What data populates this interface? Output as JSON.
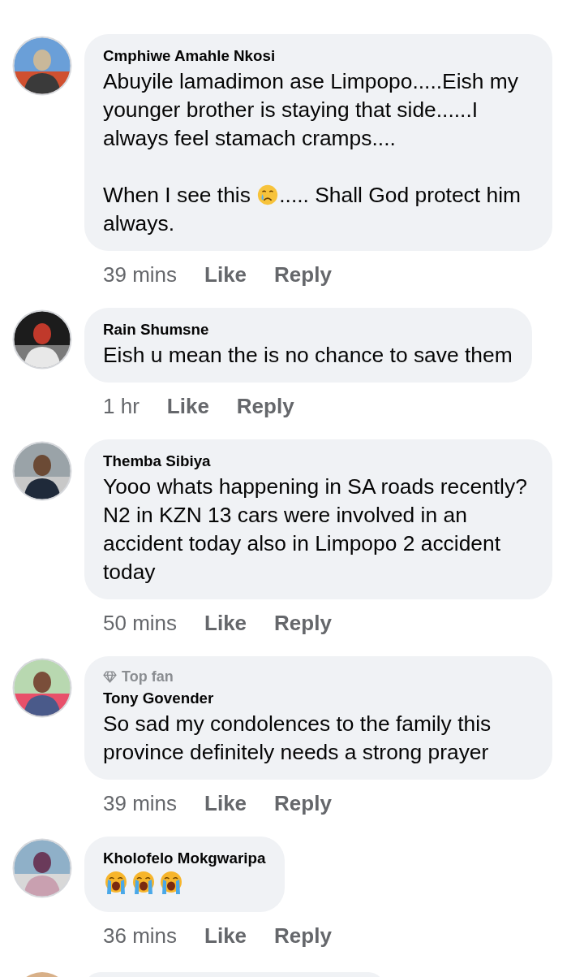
{
  "comments": [
    {
      "kind": "comment",
      "name": "Cmphiwe Amahle Nkosi",
      "paragraphs": [
        [
          {
            "kind": "text",
            "text": "Abuyile lamadimon ase Limpopo.....Eish my younger brother is staying that side......I always feel stamach cramps...."
          }
        ],
        [
          {
            "kind": "text",
            "text": "When I see this "
          },
          {
            "kind": "sad-emoji"
          },
          {
            "kind": "text",
            "text": "..... Shall God protect him always."
          }
        ]
      ],
      "time": "39 mins",
      "like": "Like",
      "reply": "Reply"
    },
    {
      "kind": "comment",
      "name": "Rain Shumsne",
      "paragraphs": [
        [
          {
            "kind": "text",
            "text": "Eish u mean the is no chance to save them"
          }
        ]
      ],
      "time": "1 hr",
      "like": "Like",
      "reply": "Reply"
    },
    {
      "kind": "comment",
      "name": "Themba Sibiya",
      "paragraphs": [
        [
          {
            "kind": "text",
            "text": "Yooo whats happening in SA roads recently? N2 in KZN 13 cars were involved in an accident today also in Limpopo 2 accident today"
          }
        ]
      ],
      "time": "50 mins",
      "like": "Like",
      "reply": "Reply"
    },
    {
      "kind": "comment",
      "badge": "Top fan",
      "name": "Tony Govender",
      "paragraphs": [
        [
          {
            "kind": "text",
            "text": "So sad my condolences to the family this province definitely needs a strong prayer"
          }
        ]
      ],
      "time": "39 mins",
      "like": "Like",
      "reply": "Reply"
    },
    {
      "kind": "comment",
      "name": "Kholofelo Mokgwaripa",
      "paragraphs": [
        [
          {
            "kind": "crying-emoji"
          },
          {
            "kind": "crying-emoji"
          },
          {
            "kind": "crying-emoji"
          }
        ]
      ],
      "time": "36 mins",
      "like": "Like",
      "reply": "Reply"
    },
    {
      "kind": "partial"
    }
  ]
}
